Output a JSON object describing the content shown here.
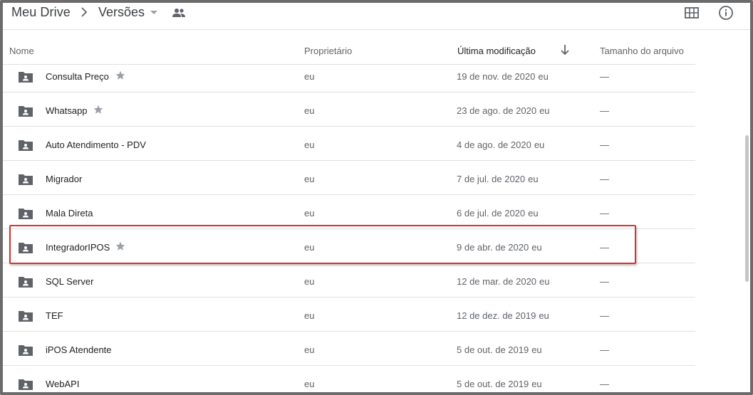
{
  "breadcrumb": {
    "root": "Meu Drive",
    "current": "Versões"
  },
  "icons": {
    "separator": "chevron-right-icon",
    "dropdown": "caret-down-icon",
    "shared": "people-icon",
    "grid": "grid-view-icon",
    "info": "info-icon",
    "sort": "arrow-down-icon",
    "folder": "shared-folder-icon",
    "star": "star-icon"
  },
  "columns": {
    "name": "Nome",
    "owner": "Proprietário",
    "modified": "Última modificação",
    "size": "Tamanho do arquivo"
  },
  "files": [
    {
      "name": "Consulta Preço",
      "starred": true,
      "owner": "eu",
      "modified": "19 de nov. de 2020",
      "modified_by": "eu",
      "size": "—"
    },
    {
      "name": "Whatsapp",
      "starred": true,
      "owner": "eu",
      "modified": "23 de ago. de 2020",
      "modified_by": "eu",
      "size": "—"
    },
    {
      "name": "Auto Atendimento - PDV",
      "starred": false,
      "owner": "eu",
      "modified": "4 de ago. de 2020",
      "modified_by": "eu",
      "size": "—"
    },
    {
      "name": "Migrador",
      "starred": false,
      "owner": "eu",
      "modified": "7 de jul. de 2020",
      "modified_by": "eu",
      "size": "—"
    },
    {
      "name": "Mala Direta",
      "starred": false,
      "owner": "eu",
      "modified": "6 de jul. de 2020",
      "modified_by": "eu",
      "size": "—"
    },
    {
      "name": "IntegradorIPOS",
      "starred": true,
      "owner": "eu",
      "modified": "9 de abr. de 2020",
      "modified_by": "eu",
      "size": "—"
    },
    {
      "name": "SQL Server",
      "starred": false,
      "owner": "eu",
      "modified": "12 de mar. de 2020",
      "modified_by": "eu",
      "size": "—"
    },
    {
      "name": "TEF",
      "starred": false,
      "owner": "eu",
      "modified": "12 de dez. de 2019",
      "modified_by": "eu",
      "size": "—"
    },
    {
      "name": "iPOS Atendente",
      "starred": false,
      "owner": "eu",
      "modified": "5 de out. de 2019",
      "modified_by": "eu",
      "size": "—"
    },
    {
      "name": "WebAPI",
      "starred": false,
      "owner": "eu",
      "modified": "5 de out. de 2019",
      "modified_by": "eu",
      "size": "—"
    }
  ],
  "colors": {
    "highlight_border": "#d9302e",
    "icon_gray": "#5f6368",
    "star_gray": "#9aa0a6"
  }
}
